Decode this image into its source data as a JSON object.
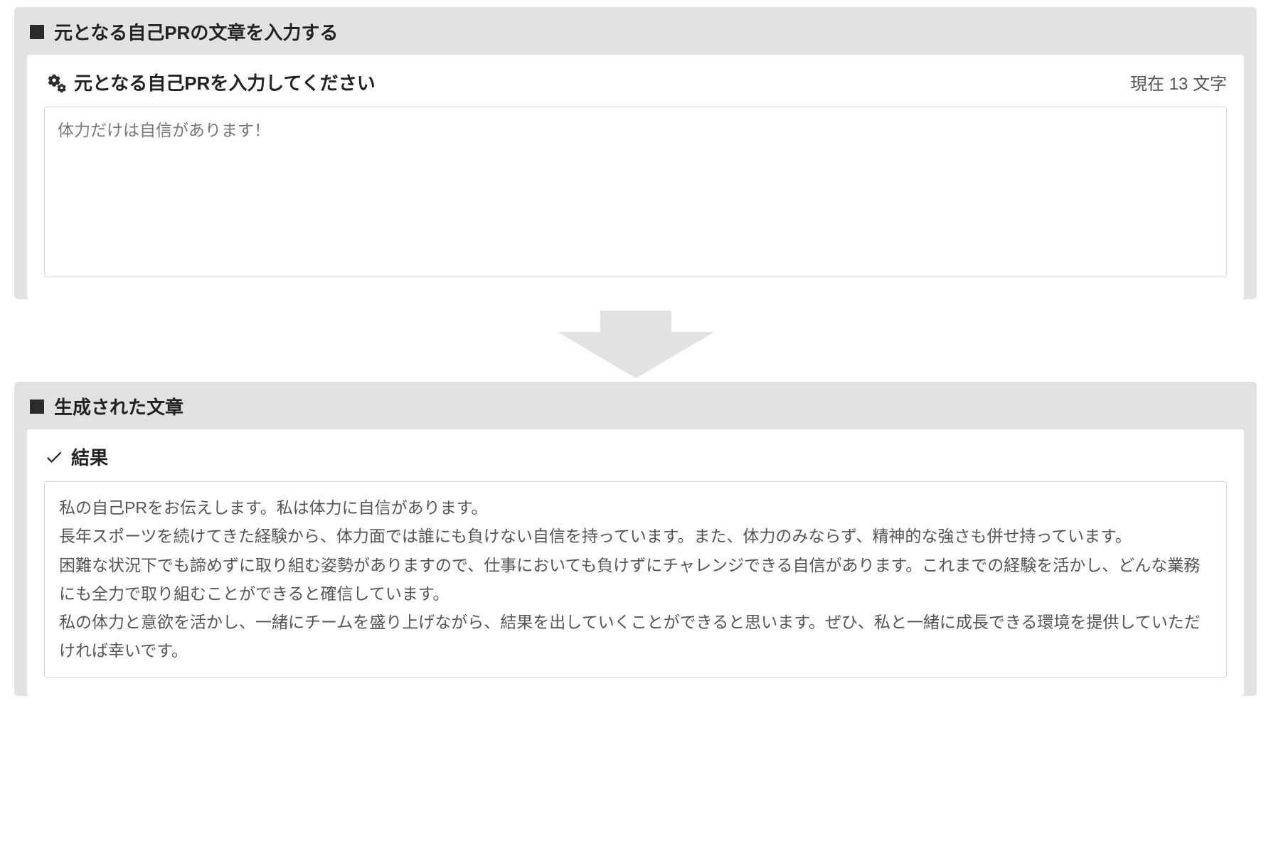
{
  "input_section": {
    "title": "元となる自己PRの文章を入力する",
    "sub_title": "元となる自己PRを入力してください",
    "char_count_label": "現在 13 文字",
    "textarea_value": "体力だけは自信があります！"
  },
  "output_section": {
    "title": "生成された文章",
    "sub_title": "結果",
    "result_text": "私の自己PRをお伝えします。私は体力に自信があります。\n長年スポーツを続けてきた経験から、体力面では誰にも負けない自信を持っています。また、体力のみならず、精神的な強さも併せ持っています。\n困難な状況下でも諦めずに取り組む姿勢がありますので、仕事においても負けずにチャレンジできる自信があります。これまでの経験を活かし、どんな業務にも全力で取り組むことができると確信しています。\n私の体力と意欲を活かし、一緒にチームを盛り上げながら、結果を出していくことができると思います。ぜひ、私と一緒に成長できる環境を提供していただければ幸いです。"
  }
}
